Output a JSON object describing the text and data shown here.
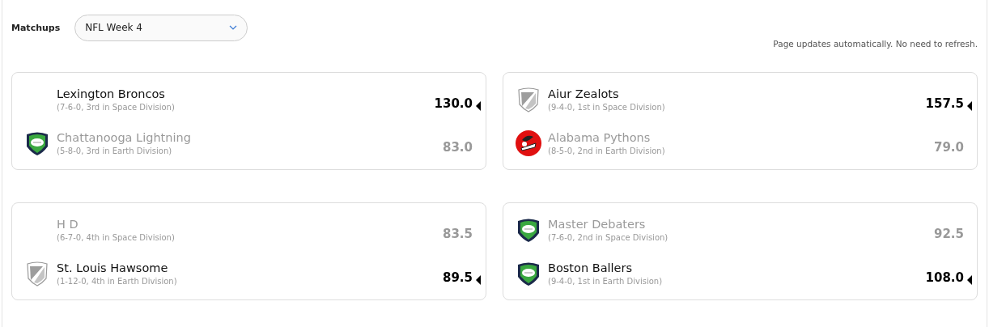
{
  "header": {
    "label": "Matchups",
    "week_select": {
      "value": "NFL Week 4"
    },
    "notice": "Page updates automatically. No need to refresh."
  },
  "matchups": [
    {
      "teams": [
        {
          "name": "Lexington Broncos",
          "record": "(7-6-0, 3rd in Space Division)",
          "score": "130.0",
          "winner": true,
          "kind": "none"
        },
        {
          "name": "Chattanooga Lightning",
          "record": "(5-8-0, 3rd in Earth Division)",
          "score": "83.0",
          "winner": false,
          "kind": "football-shield"
        }
      ]
    },
    {
      "teams": [
        {
          "name": "Aiur Zealots",
          "record": "(9-4-0, 1st in Space Division)",
          "score": "157.5",
          "winner": true,
          "kind": "gray-shield"
        },
        {
          "name": "Alabama Pythons",
          "record": "(8-5-0, 2nd in Earth Division)",
          "score": "79.0",
          "winner": false,
          "kind": "red-circle"
        }
      ]
    },
    {
      "teams": [
        {
          "name": "H D",
          "record": "(6-7-0, 4th in Space Division)",
          "score": "83.5",
          "winner": false,
          "kind": "none"
        },
        {
          "name": "St. Louis Hawsome",
          "record": "(1-12-0, 4th in Earth Division)",
          "score": "89.5",
          "winner": true,
          "kind": "gray-shield"
        }
      ]
    },
    {
      "teams": [
        {
          "name": "Master Debaters",
          "record": "(7-6-0, 2nd in Space Division)",
          "score": "92.5",
          "winner": false,
          "kind": "football-shield"
        },
        {
          "name": "Boston Ballers",
          "record": "(9-4-0, 1st in Earth Division)",
          "score": "108.0",
          "winner": true,
          "kind": "football-shield"
        }
      ]
    }
  ]
}
